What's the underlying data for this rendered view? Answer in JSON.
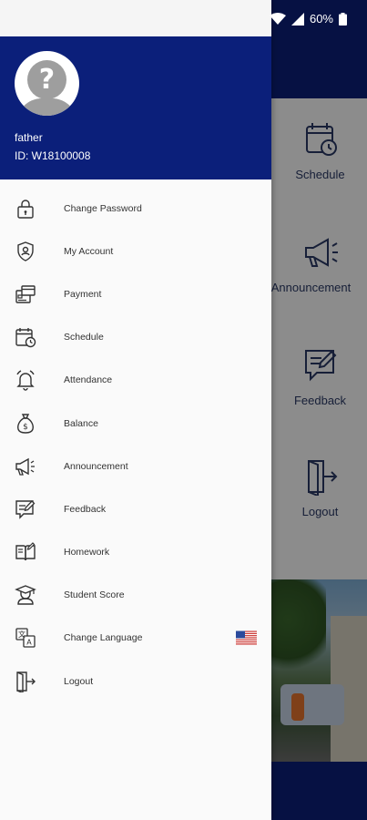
{
  "statusbar": {
    "battery": "60%"
  },
  "background": {
    "tiles": [
      {
        "label": "Schedule",
        "icon": "calendar-clock-icon"
      },
      {
        "label": "Announcement",
        "icon": "megaphone-icon"
      },
      {
        "label": "Feedback",
        "icon": "feedback-icon"
      },
      {
        "label": "Logout",
        "icon": "logout-icon"
      }
    ]
  },
  "drawer": {
    "user": {
      "name": "father",
      "id": "ID: W18100008",
      "avatar_icon": "question-avatar-icon"
    },
    "items": [
      {
        "label": "Change Password",
        "icon": "lock-icon"
      },
      {
        "label": "My Account",
        "icon": "account-shield-icon"
      },
      {
        "label": "Payment",
        "icon": "payment-icon"
      },
      {
        "label": "Schedule",
        "icon": "calendar-clock-icon"
      },
      {
        "label": "Attendance",
        "icon": "bell-icon"
      },
      {
        "label": "Balance",
        "icon": "money-bag-icon"
      },
      {
        "label": "Announcement",
        "icon": "megaphone-icon"
      },
      {
        "label": "Feedback",
        "icon": "feedback-icon"
      },
      {
        "label": "Homework",
        "icon": "homework-book-icon"
      },
      {
        "label": "Student Score",
        "icon": "graduate-icon"
      },
      {
        "label": "Change Language",
        "icon": "translate-icon",
        "flag": "us-flag-icon"
      },
      {
        "label": "Logout",
        "icon": "logout-icon"
      }
    ]
  },
  "colors": {
    "header": "#0b1f7a",
    "drawer_bg": "#fafafa",
    "text": "#333333"
  }
}
